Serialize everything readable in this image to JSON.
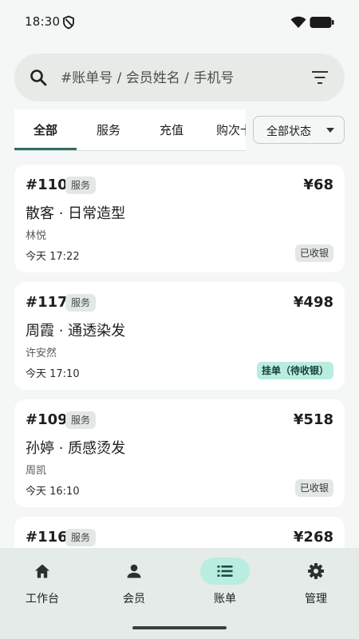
{
  "status_bar": {
    "time": "18:30"
  },
  "search": {
    "placeholder": "#账单号 / 会员姓名 / 手机号",
    "value": ""
  },
  "tabs": [
    {
      "label": "全部",
      "active": true
    },
    {
      "label": "服务",
      "active": false
    },
    {
      "label": "充值",
      "active": false
    },
    {
      "label": "购次卡",
      "active": false
    }
  ],
  "status_filter": {
    "selected": "全部状态"
  },
  "orders": [
    {
      "id": "#110",
      "type": "服务",
      "amount": "¥68",
      "title": "散客 · 日常造型",
      "staff": "林悦",
      "time": "今天 17:22",
      "status": "已收银",
      "status_kind": "done"
    },
    {
      "id": "#117",
      "type": "服务",
      "amount": "¥498",
      "title": "周霞 · 通透染发",
      "staff": "许安然",
      "time": "今天 17:10",
      "status": "挂单（待收银）",
      "status_kind": "pending"
    },
    {
      "id": "#109",
      "type": "服务",
      "amount": "¥518",
      "title": "孙婷 · 质感烫发",
      "staff": "周凯",
      "time": "今天 16:10",
      "status": "已收银",
      "status_kind": "done"
    },
    {
      "id": "#116",
      "type": "服务",
      "amount": "¥268",
      "title": "",
      "staff": "",
      "time": "",
      "status": "",
      "status_kind": ""
    }
  ],
  "nav": [
    {
      "label": "工作台",
      "icon": "home-icon",
      "active": false
    },
    {
      "label": "会员",
      "icon": "person-icon",
      "active": false
    },
    {
      "label": "账单",
      "icon": "list-icon",
      "active": true
    },
    {
      "label": "管理",
      "icon": "gear-icon",
      "active": false
    }
  ],
  "colors": {
    "accent": "#2e6e63",
    "pending_badge_bg": "#b8ede0",
    "background": "#f4f7f5",
    "nav_bg": "#e5ebe8"
  }
}
